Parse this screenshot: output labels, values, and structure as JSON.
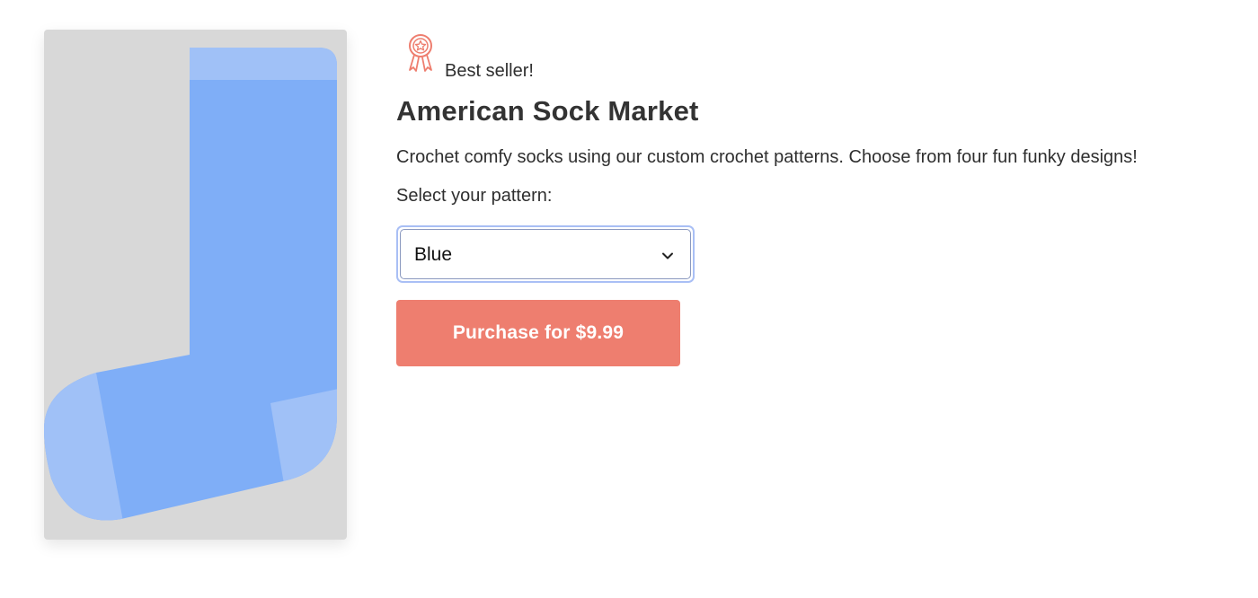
{
  "product": {
    "badge_text": "Best seller!",
    "badge_icon": "award-ribbon-icon",
    "title": "American Sock Market",
    "description": "Crochet comfy socks using our custom crochet patterns. Choose from four fun funky designs!",
    "select_label": "Select your pattern:",
    "pattern_select": {
      "selected": "Blue"
    },
    "purchase_button_label": "Purchase for $9.99"
  },
  "colors": {
    "accent": "#ee7e6f",
    "sock_main": "#7faef7",
    "sock_light": "#a0c1f7",
    "image_background": "#d8d8d8",
    "select_focus_ring": "#a9bff5"
  }
}
